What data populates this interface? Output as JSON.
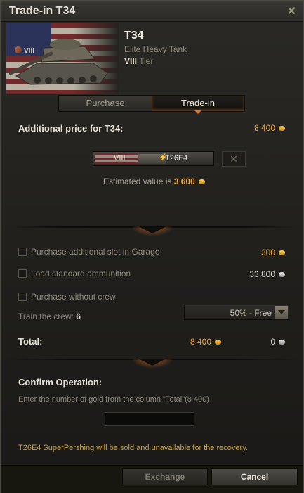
{
  "window": {
    "title": "Trade-in T34",
    "close_icon": "close-icon"
  },
  "tank": {
    "tier_badge": "VIII",
    "name": "T34",
    "class": "Elite Heavy Tank",
    "tier_value": "VIII",
    "tier_word": " Tier"
  },
  "tabs": [
    {
      "label": "Purchase",
      "active": false
    },
    {
      "label": "Trade-in",
      "active": true
    }
  ],
  "additional_price": {
    "label": "Additional price for T34:",
    "value": "8 400",
    "currency": "gold"
  },
  "trade_in_slot": {
    "tier": "VIII",
    "tank_name": "T26E4",
    "remove_icon": "close-icon"
  },
  "estimate": {
    "prefix": "Estimated value is ",
    "value": "3 600",
    "currency": "gold"
  },
  "options": {
    "slot": {
      "label": "Purchase additional slot in Garage",
      "checked": false,
      "price": "300",
      "currency": "gold"
    },
    "ammo": {
      "label": "Load standard ammunition",
      "checked": false,
      "price": "33 800",
      "currency": "credits"
    },
    "crew": {
      "label": "Purchase without crew",
      "checked": false
    }
  },
  "train_crew": {
    "label": "Train the crew: ",
    "value": "6",
    "option": "50% - Free"
  },
  "total": {
    "label": "Total:",
    "gold": "8 400",
    "credits": "0"
  },
  "confirm": {
    "title": "Confirm Operation:",
    "instruction_prefix": "Enter the number of gold from the column \"Total\"(",
    "instruction_value": "8 400",
    "instruction_suffix": ")",
    "input_value": ""
  },
  "warning": "T26E4 SuperPershing will be sold and unavailable for the recovery.",
  "buttons": {
    "exchange": "Exchange",
    "cancel": "Cancel"
  },
  "colors": {
    "gold": "#f0a43c",
    "accent": "#e07a2a",
    "warning": "#c9a44c"
  }
}
